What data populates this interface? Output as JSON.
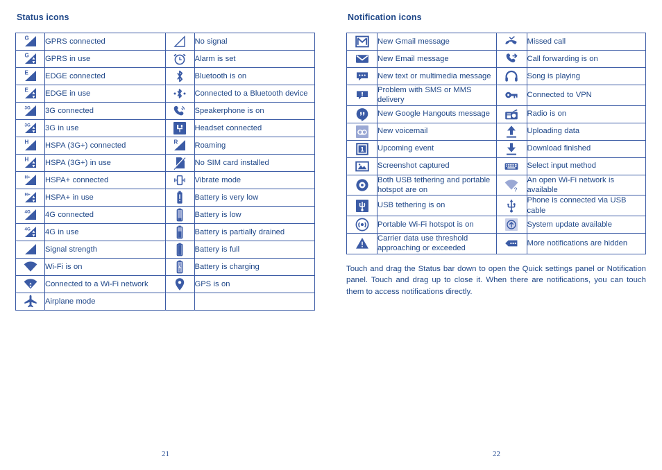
{
  "colors": {
    "text_blue": "#1f4788",
    "icon_blue": "#3b5ba5",
    "icon_light": "#9aa8d4",
    "border_blue": "#3b5ba5"
  },
  "left_column": {
    "title": "Status icons",
    "rows": [
      {
        "icon_a": "gprs-connected-icon",
        "label_a": "GPRS connected",
        "icon_b": "no-signal-icon",
        "label_b": "No signal"
      },
      {
        "icon_a": "gprs-in-use-icon",
        "label_a": "GPRS in use",
        "icon_b": "alarm-icon",
        "label_b": "Alarm is set"
      },
      {
        "icon_a": "edge-connected-icon",
        "label_a": "EDGE connected",
        "icon_b": "bluetooth-icon",
        "label_b": "Bluetooth is on"
      },
      {
        "icon_a": "edge-in-use-icon",
        "label_a": "EDGE in use",
        "icon_b": "bluetooth-connected-icon",
        "label_b": "Connected to a Bluetooth device"
      },
      {
        "icon_a": "3g-connected-icon",
        "label_a": "3G connected",
        "icon_b": "speakerphone-icon",
        "label_b": "Speakerphone is on"
      },
      {
        "icon_a": "3g-in-use-icon",
        "label_a": "3G in use",
        "icon_b": "headset-icon",
        "label_b": "Headset connected"
      },
      {
        "icon_a": "hspa-connected-icon",
        "label_a": "HSPA (3G+) connected",
        "icon_b": "roaming-icon",
        "label_b": "Roaming"
      },
      {
        "icon_a": "hspa-in-use-icon",
        "label_a": "HSPA (3G+) in use",
        "icon_b": "no-sim-card-icon",
        "label_b": "No SIM card installed"
      },
      {
        "icon_a": "hspa-plus-connected-icon",
        "label_a": "HSPA+ connected",
        "icon_b": "vibrate-icon",
        "label_b": "Vibrate mode"
      },
      {
        "icon_a": "hspa-plus-in-use-icon",
        "label_a": "HSPA+ in use",
        "icon_b": "battery-very-low-icon",
        "label_b": "Battery is very low"
      },
      {
        "icon_a": "4g-connected-icon",
        "label_a": "4G connected",
        "icon_b": "battery-low-icon",
        "label_b": "Battery is low"
      },
      {
        "icon_a": "4g-in-use-icon",
        "label_a": "4G in use",
        "icon_b": "battery-partial-icon",
        "label_b": "Battery is partially drained"
      },
      {
        "icon_a": "signal-strength-icon",
        "label_a": "Signal strength",
        "icon_b": "battery-full-icon",
        "label_b": "Battery is full"
      },
      {
        "icon_a": "wifi-on-icon",
        "label_a": "Wi-Fi is on",
        "icon_b": "battery-charging-icon",
        "label_b": "Battery is charging"
      },
      {
        "icon_a": "wifi-connected-icon",
        "label_a": "Connected to a Wi-Fi network",
        "icon_b": "gps-icon",
        "label_b": "GPS is on"
      },
      {
        "icon_a": "airplane-mode-icon",
        "label_a": "Airplane mode",
        "icon_b": "",
        "label_b": ""
      }
    ]
  },
  "right_column": {
    "title": "Notification icons",
    "rows": [
      {
        "icon_a": "gmail-icon",
        "label_a": "New Gmail message",
        "icon_b": "missed-call-icon",
        "label_b": "Missed call"
      },
      {
        "icon_a": "email-icon",
        "label_a": "New Email message",
        "icon_b": "call-forwarding-icon",
        "label_b": "Call forwarding is on"
      },
      {
        "icon_a": "sms-message-icon",
        "label_a": "New text or multimedia message",
        "icon_b": "headphones-icon",
        "label_b": "Song is playing"
      },
      {
        "icon_a": "sms-problem-icon",
        "label_a": "Problem with SMS or MMS delivery",
        "icon_b": "vpn-key-icon",
        "label_b": "Connected to VPN"
      },
      {
        "icon_a": "hangouts-icon",
        "label_a": "New Google Hangouts message",
        "icon_b": "radio-icon",
        "label_b": "Radio is on"
      },
      {
        "icon_a": "voicemail-icon",
        "label_a": "New voicemail",
        "icon_b": "upload-icon",
        "label_b": "Uploading data"
      },
      {
        "icon_a": "calendar-event-icon",
        "label_a": "Upcoming event",
        "icon_b": "download-icon",
        "label_b": "Download finished"
      },
      {
        "icon_a": "screenshot-icon",
        "label_a": "Screenshot captured",
        "icon_b": "keyboard-icon",
        "label_b": "Select input method"
      },
      {
        "icon_a": "usb-tether-hotspot-icon",
        "label_a": "Both USB tethering and portable hotspot are on",
        "icon_b": "open-wifi-icon",
        "label_b": "An open Wi-Fi network is available"
      },
      {
        "icon_a": "usb-tethering-icon",
        "label_a": "USB tethering is on",
        "icon_b": "usb-cable-icon",
        "label_b": "Phone is connected via USB cable"
      },
      {
        "icon_a": "portable-hotspot-icon",
        "label_a": "Portable Wi-Fi hotspot is on",
        "icon_b": "system-update-icon",
        "label_b": "System update available"
      },
      {
        "icon_a": "data-warning-icon",
        "label_a": "Carrier data use threshold approaching or exceeded",
        "icon_b": "more-notifications-icon",
        "label_b": "More notifications are hidden"
      }
    ],
    "footnote": "Touch and drag the Status bar down to open the Quick settings panel or Notification panel. Touch and drag up to close it. When there are notifications, you can touch them to access notifications directly."
  },
  "page_numbers": {
    "left": "21",
    "right": "22"
  }
}
